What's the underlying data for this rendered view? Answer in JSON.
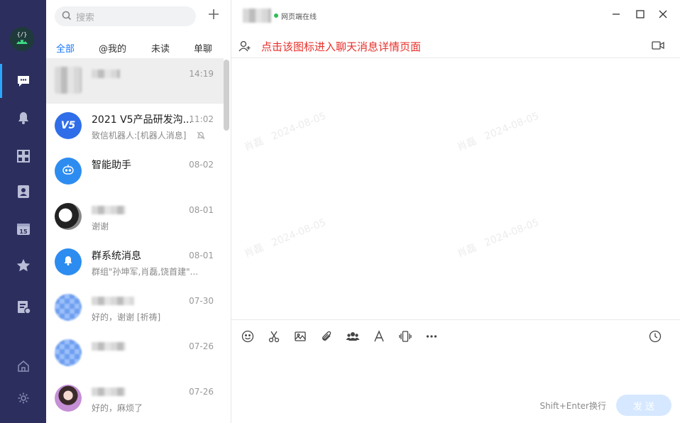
{
  "rail": {
    "items": [
      {
        "icon": "chat-icon",
        "active": true
      },
      {
        "icon": "bell-icon"
      },
      {
        "icon": "apps-grid-icon"
      },
      {
        "icon": "contacts-icon"
      },
      {
        "icon": "calendar-icon",
        "badge": "15"
      },
      {
        "icon": "star-icon"
      },
      {
        "icon": "tasks-icon"
      }
    ],
    "bottom": [
      {
        "icon": "home-icon"
      },
      {
        "icon": "settings-icon"
      }
    ]
  },
  "search": {
    "placeholder": "搜索"
  },
  "tabs": [
    "全部",
    "@我的",
    "未读",
    "单聊"
  ],
  "conversations": [
    {
      "name": "",
      "time": "14:19",
      "message": ""
    },
    {
      "name": "2021 V5产品研发沟...",
      "time": "11:02",
      "message": "致信机器人:[机器人消息]",
      "avatar_text": "V5"
    },
    {
      "name": "智能助手",
      "time": "08-02",
      "message": ""
    },
    {
      "name": "",
      "time": "08-01",
      "message": "谢谢"
    },
    {
      "name": "群系统消息",
      "time": "08-01",
      "message": "群组\"孙坤军,肖磊,饶首建\"..."
    },
    {
      "name": "",
      "time": "07-30",
      "message": "好的，谢谢 [祈祷]"
    },
    {
      "name": "",
      "time": "07-26",
      "message": ""
    },
    {
      "name": "",
      "time": "07-26",
      "message": "好的，麻烦了"
    }
  ],
  "header": {
    "status": "网页端在线",
    "hint": "点击该图标进入聊天消息详情页面"
  },
  "watermark": {
    "name": "肖磊",
    "date": "2024-08-05"
  },
  "composer": {
    "shortcut": "Shift+Enter换行",
    "send_label": "发 送"
  },
  "colors": {
    "rail": "#2c2f5e",
    "accent": "#1677ff",
    "hint": "#e8302b"
  }
}
